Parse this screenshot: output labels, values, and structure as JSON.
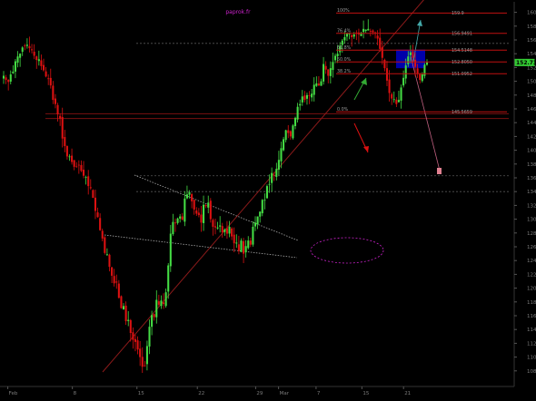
{
  "chart_data": {
    "type": "candlestick",
    "title": "paprok.fr",
    "ylim": [
      106,
      161
    ],
    "y_ticks": [
      108,
      110,
      112,
      114,
      116,
      118,
      120,
      122,
      124,
      126,
      128,
      130,
      132,
      134,
      136,
      138,
      140,
      142,
      144,
      146,
      148,
      150,
      152,
      154,
      156,
      158,
      160
    ],
    "x_tick_labels": [
      "Feb",
      "8",
      "15",
      "22",
      "29",
      "Mar",
      "7",
      "15",
      "21"
    ],
    "last_price": "152.73",
    "colors": {
      "up": "#44dd44",
      "down": "#dd1111",
      "background": "#000000",
      "axis_text": "#7a7a7a",
      "fib_line": "#c01010",
      "fib_text": "#9a9a9a",
      "title": "#cc22cc",
      "price_box": "#33cc33",
      "projection_box": "#0000aa"
    },
    "series_close": [
      150.8,
      150.2,
      149.9,
      151.0,
      151.4,
      152.9,
      153.6,
      154.0,
      154.9,
      155.1,
      155.3,
      154.8,
      154.5,
      153.7,
      153.1,
      153.2,
      152.2,
      151.6,
      150.7,
      150.4,
      149.4,
      147.3,
      146.7,
      145.2,
      144.6,
      141.7,
      140.6,
      139.1,
      139.1,
      138.3,
      137.6,
      137.6,
      137.8,
      137.0,
      136.3,
      136.1,
      134.8,
      134.5,
      133.1,
      131.2,
      130.3,
      128.4,
      127.2,
      125.1,
      124.9,
      123.1,
      121.8,
      120.7,
      120.8,
      118.6,
      117.1,
      117.4,
      115.2,
      115.4,
      113.5,
      112.5,
      112.2,
      111.1,
      110.0,
      108.6,
      108.7,
      111.6,
      114.4,
      116.1,
      115.8,
      118.3,
      117.6,
      118.2,
      117.7,
      119.4,
      123.3,
      127.9,
      129.6,
      129.4,
      130.1,
      130.4,
      129.9,
      133.0,
      133.6,
      133.9,
      132.6,
      131.4,
      130.8,
      130.6,
      129.5,
      132.1,
      131.9,
      132.4,
      130.0,
      128.9,
      128.8,
      128.8,
      129.1,
      128.1,
      128.5,
      127.9,
      128.9,
      127.5,
      126.5,
      126.6,
      125.4,
      126.9,
      125.0,
      126.1,
      126.9,
      126.3,
      128.9,
      129.5,
      130.4,
      131.1,
      132.8,
      132.8,
      134.8,
      135.1,
      136.7,
      136.4,
      137.3,
      138.6,
      140.3,
      141.6,
      142.9,
      142.5,
      142.0,
      143.6,
      144.7,
      146.3,
      146.7,
      147.8,
      147.3,
      148.0,
      147.9,
      148.2,
      149.5,
      149.7,
      149.4,
      150.0,
      152.5,
      151.7,
      150.8,
      151.9,
      152.8,
      153.7,
      154.0,
      155.1,
      155.9,
      156.4,
      156.9,
      156.9,
      156.4,
      156.8,
      157.0,
      156.8,
      157.0,
      157.6,
      157.5,
      157.6,
      157.3,
      157.1,
      156.9,
      156.2,
      154.7,
      153.4,
      151.9,
      150.1,
      148.3,
      147.5,
      147.4,
      146.7,
      147.3,
      149.1,
      150.5,
      152.3,
      153.6,
      154.2,
      153.4,
      152.1,
      151.1,
      150.2,
      151.0,
      152.4,
      152.73
    ],
    "fib_levels": [
      {
        "label": "100%",
        "value": "159.9",
        "price": 159.9
      },
      {
        "label": "76.4%",
        "value": "156.9491",
        "price": 156.9491
      },
      {
        "label": "61.8%",
        "value": "154.5148",
        "price": 154.5148
      },
      {
        "label": "50.0%",
        "value": "152.8050",
        "price": 152.805
      },
      {
        "label": "38.2%",
        "value": "151.0952",
        "price": 151.0952
      },
      {
        "label": "0.0%",
        "value": "145.5659",
        "price": 145.5659
      }
    ],
    "horizontal_levels": [
      155.5,
      145.3,
      144.6,
      136.3,
      134.0
    ],
    "grid": false,
    "legend": "none"
  }
}
